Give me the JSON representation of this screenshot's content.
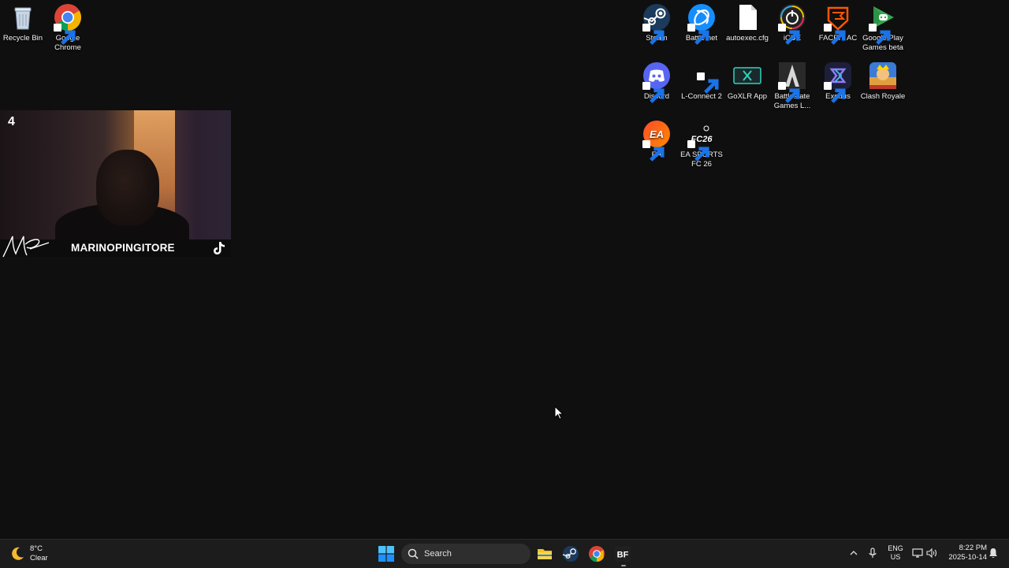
{
  "desktop": {
    "icons": [
      {
        "label": "Recycle Bin",
        "icon": "recycle-bin-icon"
      },
      {
        "label": "Google Chrome",
        "icon": "chrome-icon"
      },
      {
        "label": "Steam",
        "icon": "steam-icon"
      },
      {
        "label": "Battle.net",
        "icon": "battlenet-icon"
      },
      {
        "label": "autoexec.cfg",
        "icon": "file-icon"
      },
      {
        "label": "iCUE",
        "icon": "icue-icon"
      },
      {
        "label": "FACEIT AC",
        "icon": "faceit-icon"
      },
      {
        "label": "Google Play Games beta",
        "icon": "google-play-games-icon"
      },
      {
        "label": "Discord",
        "icon": "discord-icon"
      },
      {
        "label": "L-Connect 2",
        "icon": "lconnect-icon"
      },
      {
        "label": "GoXLR App",
        "icon": "goxlr-icon"
      },
      {
        "label": "Battlestate Games L...",
        "icon": "battlestate-icon"
      },
      {
        "label": "Exodus",
        "icon": "exodus-icon"
      },
      {
        "label": "Clash Royale",
        "icon": "clash-royale-icon"
      },
      {
        "label": "EA",
        "icon": "ea-icon"
      },
      {
        "label": "EA SPORTS FC 26",
        "icon": "fc26-icon"
      }
    ]
  },
  "webcam": {
    "number": "4",
    "name": "MARINOPINGITORE",
    "signature": "MP"
  },
  "taskbar": {
    "weather": {
      "temp": "8°C",
      "condition": "Clear"
    },
    "search": {
      "placeholder": "Search"
    },
    "apps": [
      {
        "name": "File Explorer",
        "icon": "file-explorer-icon"
      },
      {
        "name": "Steam",
        "icon": "steam-icon"
      },
      {
        "name": "Google Chrome",
        "icon": "chrome-icon"
      },
      {
        "name": "Battlefield",
        "icon": "bf-icon",
        "text": "BF"
      }
    ],
    "tray": {
      "lang_line1": "ENG",
      "lang_line2": "US",
      "time": "8:22 PM",
      "date": "2025-10-14"
    }
  },
  "colors": {
    "desktop_bg": "#0f0f0f",
    "taskbar_bg": "#1c1c1c",
    "accent": "#0078d4"
  }
}
